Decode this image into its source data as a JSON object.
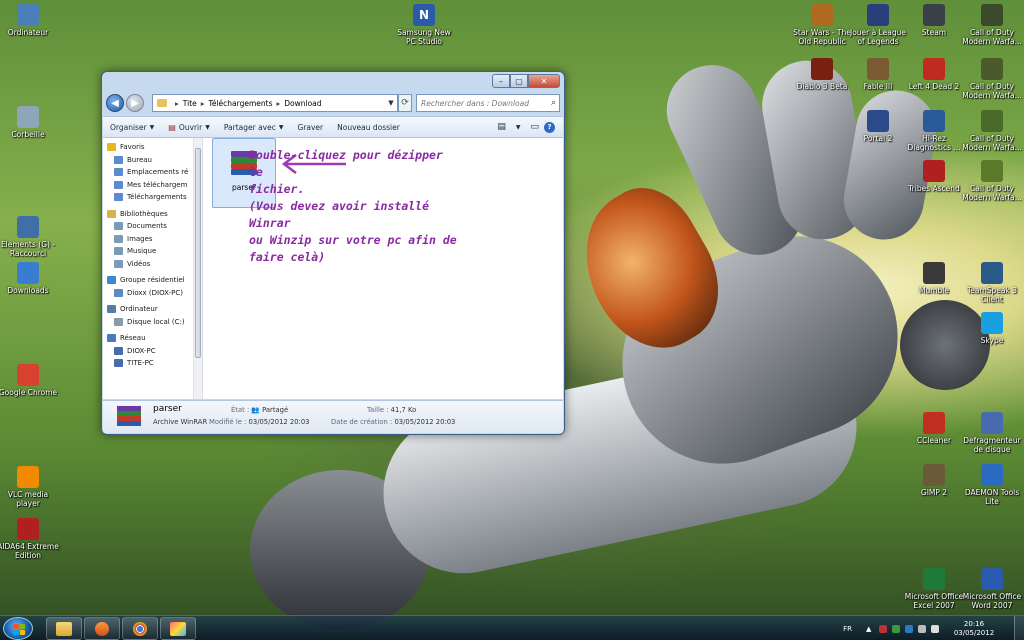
{
  "desktop": {
    "icons_left": [
      {
        "label": "Ordinateur",
        "icon": "computer-icon",
        "color": "#4a7fb8"
      },
      {
        "label": "Corbeille",
        "icon": "recycle-bin-icon",
        "color": "#8fa6b8"
      },
      {
        "label": "Elements (G) - Raccourci",
        "icon": "drive-shortcut-icon",
        "color": "#3f6fa8"
      },
      {
        "label": "Downloads",
        "icon": "downloads-folder-icon",
        "color": "#3a7dd0"
      },
      {
        "label": "Google Chrome",
        "icon": "chrome-icon",
        "color": "#d8402f"
      },
      {
        "label": "VLC media player",
        "icon": "vlc-icon",
        "color": "#f08a00"
      },
      {
        "label": "AIDA64 Extreme Edition",
        "icon": "aida64-icon",
        "color": "#b02020"
      }
    ],
    "icon_samsung": {
      "label": "Samsung New PC Studio",
      "icon": "samsung-pc-studio-icon",
      "color": "#2a5ba8"
    },
    "icons_right": [
      {
        "label": "Star Wars - The Old Republic",
        "icon": "swtor-icon",
        "color": "#b06a20"
      },
      {
        "label": "Jouer à League of Legends",
        "icon": "lol-icon",
        "color": "#2a3f7a"
      },
      {
        "label": "Steam",
        "icon": "steam-icon",
        "color": "#3a3f48"
      },
      {
        "label": "Call of Duty Modern Warfa...",
        "icon": "cod-icon",
        "color": "#3a4a2a"
      },
      {
        "label": "Diablo 3 Beta",
        "icon": "diablo-icon",
        "color": "#7a2010"
      },
      {
        "label": "Fable III",
        "icon": "fable-icon",
        "color": "#7a5a30"
      },
      {
        "label": "Left 4 Dead 2",
        "icon": "l4d2-icon",
        "color": "#c02a20"
      },
      {
        "label": "Call of Duty Modern Warfa...",
        "icon": "cod-icon",
        "color": "#4a5a2a"
      },
      {
        "label": "Portal 2",
        "icon": "portal2-icon",
        "color": "#2a4a8a"
      },
      {
        "label": "Hi-Rez Diagnostics ...",
        "icon": "hirez-icon",
        "color": "#2a5a9a"
      },
      {
        "label": "Call of Duty Modern Warfa...",
        "icon": "cod-icon",
        "color": "#4a6a2a"
      },
      {
        "label": "Tribes Ascend",
        "icon": "tribes-icon",
        "color": "#b02020"
      },
      {
        "label": "Call of Duty Modern Warfa...",
        "icon": "cod-icon",
        "color": "#5a7a2a"
      },
      {
        "label": "Mumble",
        "icon": "mumble-icon",
        "color": "#3a3a3a"
      },
      {
        "label": "TeamSpeak 3 Client",
        "icon": "teamspeak-icon",
        "color": "#2a5a8a"
      },
      {
        "label": "Skype",
        "icon": "skype-icon",
        "color": "#18a0e0"
      },
      {
        "label": "CCleaner",
        "icon": "ccleaner-icon",
        "color": "#c03020"
      },
      {
        "label": "Defragmenteur de disque",
        "icon": "defrag-icon",
        "color": "#4a6ab0"
      },
      {
        "label": "GIMP 2",
        "icon": "gimp-icon",
        "color": "#6a5a3a"
      },
      {
        "label": "DAEMON Tools Lite",
        "icon": "daemon-tools-icon",
        "color": "#2a6ac0"
      },
      {
        "label": "Microsoft Office Excel 2007",
        "icon": "excel-icon",
        "color": "#1f7a3a"
      },
      {
        "label": "Microsoft Office Word 2007",
        "icon": "word-icon",
        "color": "#2a5ab0"
      }
    ]
  },
  "explorer": {
    "address": {
      "seg1": "Tite",
      "seg2": "Téléchargements",
      "seg3": "Download"
    },
    "search_placeholder": "Rechercher dans : Download",
    "toolbar": {
      "organize": "Organiser",
      "open": "Ouvrir",
      "share": "Partager avec",
      "burn": "Graver",
      "new_folder": "Nouveau dossier"
    },
    "nav": {
      "favorites": "Favoris",
      "fav_items": [
        "Bureau",
        "Emplacements ré",
        "Mes téléchargem",
        "Téléchargements"
      ],
      "libraries": "Bibliothèques",
      "lib_items": [
        "Documents",
        "Images",
        "Musique",
        "Vidéos"
      ],
      "homegroup": "Groupe résidentiel",
      "home_items": [
        "Dioxx (DIOX-PC)"
      ],
      "computer": "Ordinateur",
      "comp_items": [
        "Disque local (C:)"
      ],
      "network": "Réseau",
      "net_items": [
        "DIOX-PC",
        "TITE-PC"
      ]
    },
    "file": {
      "name": "parser"
    },
    "details": {
      "name": "parser",
      "type": "Archive WinRAR",
      "state_label": "État :",
      "state_value": "Partagé",
      "size_label": "Taille :",
      "size_value": "41,7 Ko",
      "modified_label": "Modifié le :",
      "modified_value": "03/05/2012 20:03",
      "created_label": "Date de création :",
      "created_value": "03/05/2012 20:03"
    }
  },
  "annotation": {
    "line1": "Double-cliquez pour dézipper le",
    "line2": "fichier.",
    "line3": "(Vous devez avoir installé Winrar",
    "line4": "ou Winzip sur votre pc afin de",
    "line5": "faire celà)",
    "color": "#8a2aa3"
  },
  "taskbar": {
    "lang": "FR",
    "time": "20:16",
    "date": "03/05/2012"
  }
}
